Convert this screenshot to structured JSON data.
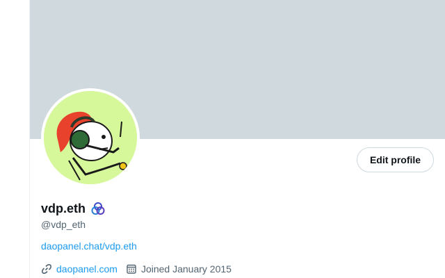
{
  "profile": {
    "display_name": "vdp.eth",
    "handle": "@vdp_eth",
    "bio_link": "daopanel.chat/vdp.eth",
    "website": "daopanel.com",
    "joined": "Joined January 2015",
    "edit_profile_label": "Edit profile"
  },
  "icons": {
    "badge": "tri-ring-badge-icon",
    "link": "link-icon",
    "calendar": "calendar-icon"
  },
  "colors": {
    "banner": "#cfd9de",
    "link": "#1d9bf0",
    "secondary_text": "#536471",
    "avatar_background": "#d6f79a"
  }
}
